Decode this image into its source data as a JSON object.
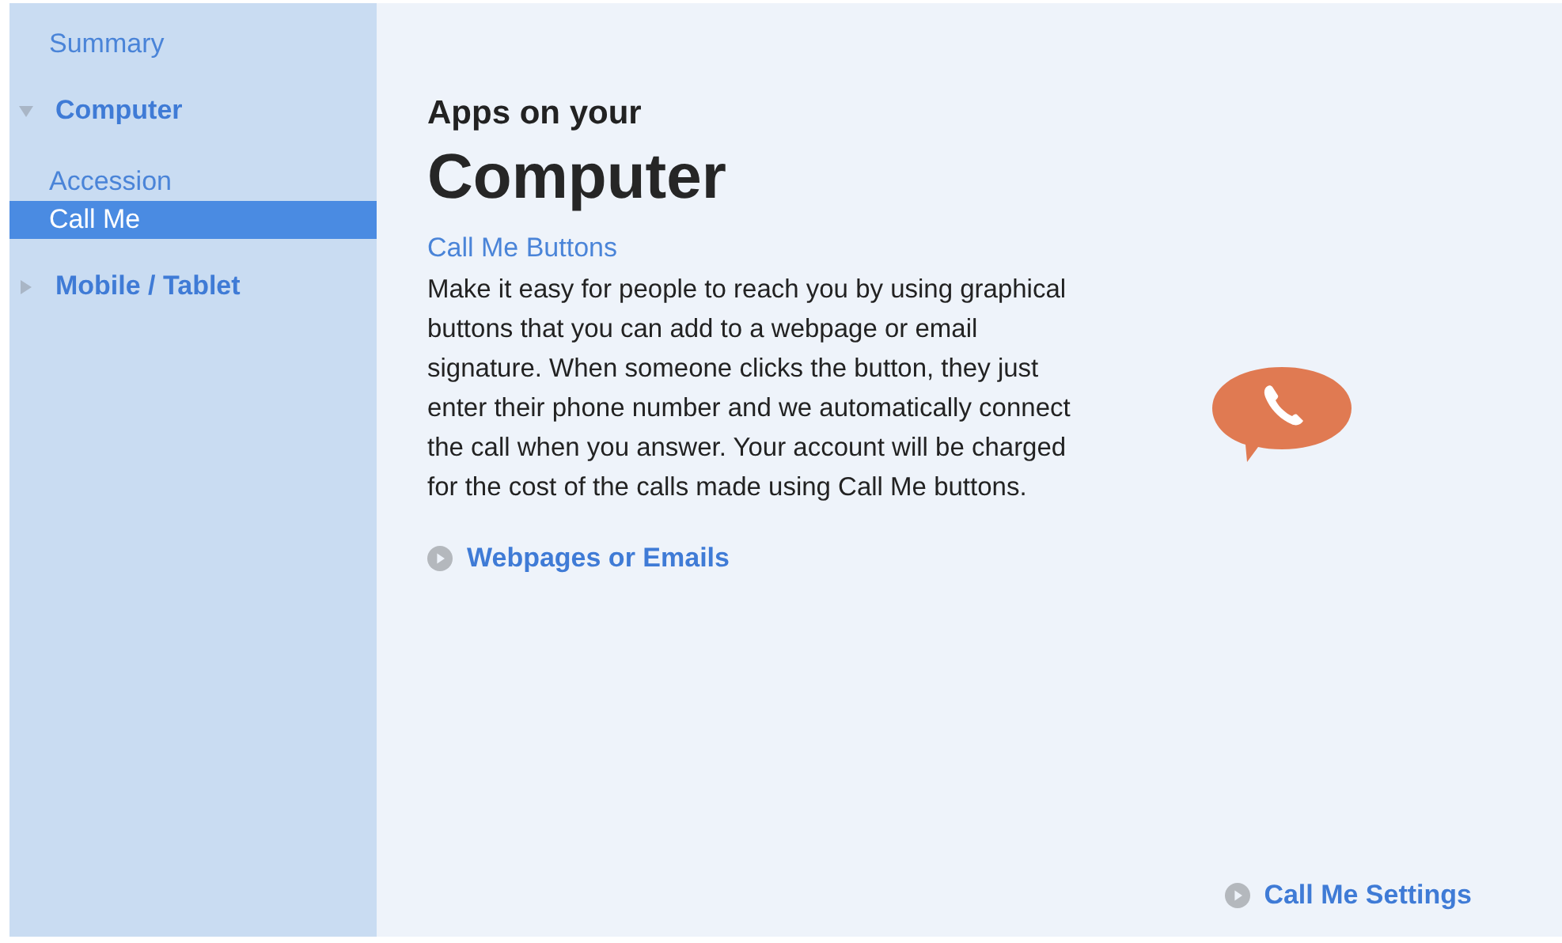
{
  "sidebar": {
    "items": [
      {
        "kind": "link",
        "label": "Summary",
        "selected": false
      },
      {
        "kind": "group",
        "label": "Computer",
        "expanded": true,
        "children": [
          {
            "label": "Accession",
            "selected": false
          },
          {
            "label": "Call Me",
            "selected": true
          }
        ]
      },
      {
        "kind": "group",
        "label": "Mobile / Tablet",
        "expanded": false
      }
    ]
  },
  "content": {
    "subtitle": "Apps on your",
    "title": "Computer",
    "section_link": "Call Me Buttons",
    "description": "Make it easy for people to reach you by using graphical buttons that you can add to a webpage or email signature. When someone clicks the button, they just enter their phone number and we automatically connect the call when you answer. Your account will be charged for the cost of the calls made using Call Me buttons.",
    "action_link": "Webpages or Emails"
  },
  "footer_link": "Call Me Settings"
}
